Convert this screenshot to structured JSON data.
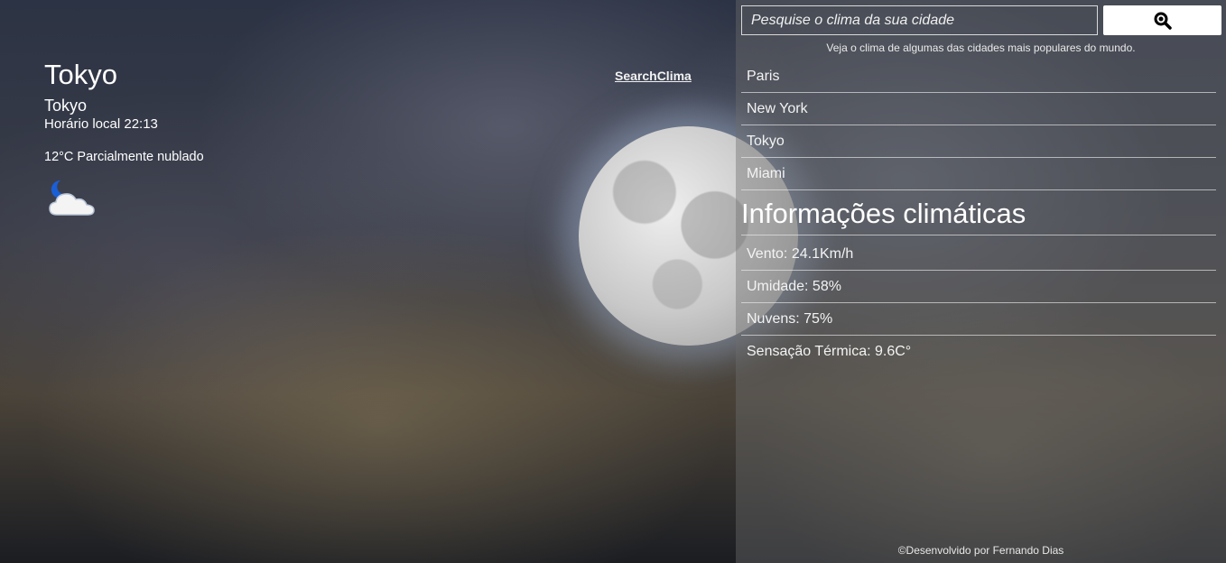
{
  "current": {
    "city_title": "Tokyo",
    "city_name": "Tokyo",
    "local_time": "Horário local 22:13",
    "condition": "12°C Parcialmente nublado",
    "icon": "night-partly-cloudy-icon"
  },
  "brand": "SearchClima",
  "search": {
    "placeholder": "Pesquise o clima da sua cidade",
    "icon": "search-icon"
  },
  "popular_hint": "Veja o clima de algumas das cidades mais populares do mundo.",
  "popular_cities": [
    "Paris",
    "New York",
    "Tokyo",
    "Miami"
  ],
  "info": {
    "title": "Informações climáticas",
    "items": [
      "Vento: 24.1Km/h",
      "Umidade: 58%",
      "Nuvens: 75%",
      "Sensação Térmica: 9.6C°"
    ]
  },
  "footer": "©Desenvolvido por Fernando Dias",
  "colors": {
    "panel_overlay": "#6e6e6e",
    "text": "#ffffff",
    "moon_icon": "#1a5fd6"
  }
}
